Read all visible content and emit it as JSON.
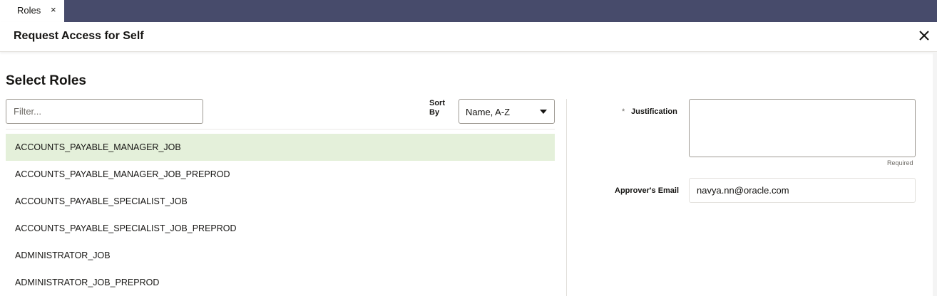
{
  "tabs": [
    {
      "label": "Roles",
      "close_glyph": "×"
    }
  ],
  "dialog": {
    "title": "Request Access for Self",
    "close_icon": "close-icon"
  },
  "section": {
    "title": "Select Roles"
  },
  "filter": {
    "placeholder": "Filter...",
    "value": ""
  },
  "sort": {
    "label": "Sort By",
    "selected": "Name, A-Z"
  },
  "roles": [
    {
      "name": "ACCOUNTS_PAYABLE_MANAGER_JOB",
      "selected": true
    },
    {
      "name": "ACCOUNTS_PAYABLE_MANAGER_JOB_PREPROD",
      "selected": false
    },
    {
      "name": "ACCOUNTS_PAYABLE_SPECIALIST_JOB",
      "selected": false
    },
    {
      "name": "ACCOUNTS_PAYABLE_SPECIALIST_JOB_PREPROD",
      "selected": false
    },
    {
      "name": "ADMINISTRATOR_JOB",
      "selected": false
    },
    {
      "name": "ADMINISTRATOR_JOB_PREPROD",
      "selected": false
    }
  ],
  "form": {
    "justification": {
      "required_marker": "*",
      "label": "Justification",
      "value": "",
      "hint": "Required"
    },
    "approver_email": {
      "label": "Approver's Email",
      "value": "navya.nn@oracle.com"
    }
  },
  "colors": {
    "tabbar": "#474b6b",
    "selected_row": "#e4f0da"
  }
}
